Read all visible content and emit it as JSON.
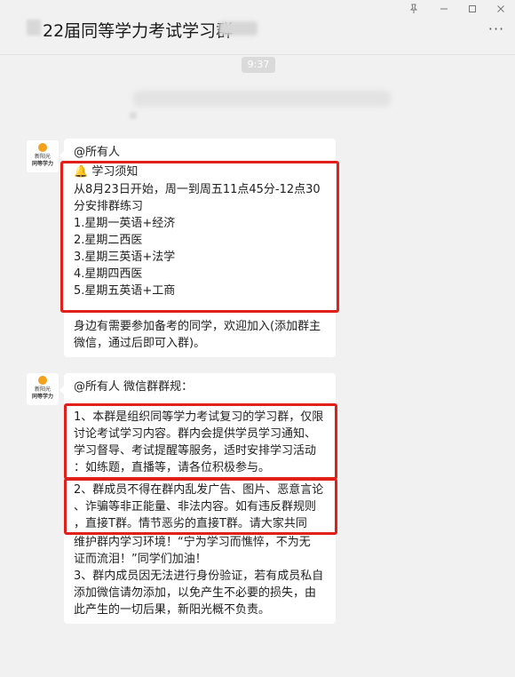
{
  "window": {
    "title": "22届同等学力考试学习群",
    "pin_icon": "pin-icon",
    "minimize_icon": "minimize-icon",
    "maximize_icon": "maximize-icon",
    "close_icon": "close-icon",
    "more_icon": "more-icon"
  },
  "chat": {
    "time_label": "9:37",
    "messages": [
      {
        "avatar_label_top": "新阳光",
        "avatar_label_bottom": "同等学力",
        "lines": [
          "@所有人",
          "🔔 学习须知",
          "从8月23日开始，周一到周五11点45分-12点30",
          "分安排群练习",
          "1.星期一英语+经济",
          "2.星期二西医",
          "3.星期三英语+法学",
          "4.星期四西医",
          "5.星期五英语+工商",
          "身边有需要参加备考的同学，欢迎加入(添加群主",
          "微信，通过后即可入群)。"
        ]
      },
      {
        "avatar_label_top": "新阳光",
        "avatar_label_bottom": "同等学力",
        "lines": [
          "@所有人 微信群群规：",
          "1、本群是组织同等学力考试复习的学习群，仅限",
          "讨论考试学习内容。群内会提供学员学习通知、",
          "学习督导、考试提醒等服务，适时安排学习活动",
          "：如练题，直播等，请各位积极参与。",
          "2、群成员不得在群内乱发广告、图片、恶意言论",
          "、诈骗等非正能量、非法内容。如有违反群规则",
          "，直接T群。情节恶劣的直接T群。请大家共同",
          "维护群内学习环境！“宁为学习而憔悴，不为无",
          "证而流泪！”同学们加油！",
          "3、群内成员因无法进行身份验证，若有成员私自",
          "添加微信请勿添加，以免产生不必要的损失，由",
          "此产生的一切后果，新阳光概不负责。"
        ]
      }
    ]
  },
  "colors": {
    "background": "#f1f1f1",
    "bubble": "#ffffff",
    "highlight_box": "#e0201b",
    "avatar_sun": "#f4a11d"
  }
}
